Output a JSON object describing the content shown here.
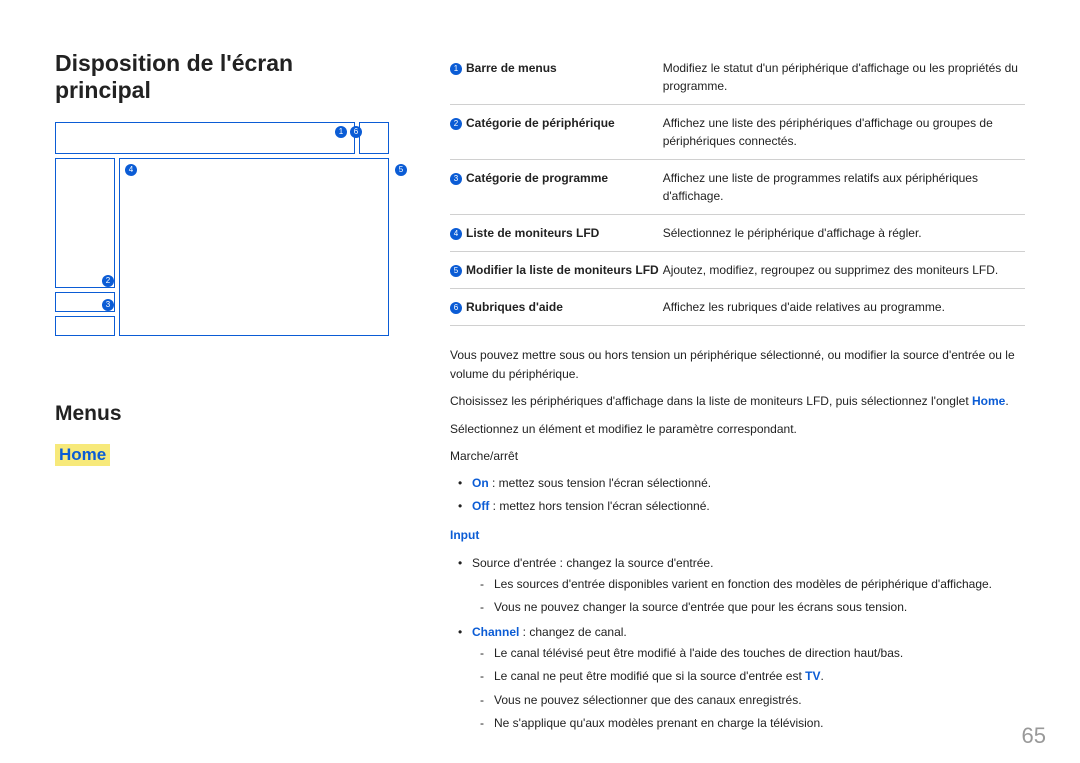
{
  "title": "Disposition de l'écran principal",
  "menus_heading": "Menus",
  "home_heading": "Home",
  "markers": {
    "m1": "1",
    "m2": "2",
    "m3": "3",
    "m4": "4",
    "m5": "5",
    "m6": "6"
  },
  "table": [
    {
      "num": "1",
      "label": "Barre de menus",
      "desc": "Modifiez le statut d'un périphérique d'affichage ou les propriétés du programme."
    },
    {
      "num": "2",
      "label": "Catégorie de périphérique",
      "desc": "Affichez une liste des périphériques d'affichage ou groupes de périphériques connectés."
    },
    {
      "num": "3",
      "label": "Catégorie de programme",
      "desc": "Affichez une liste de programmes relatifs aux périphériques d'affichage."
    },
    {
      "num": "4",
      "label": "Liste de moniteurs LFD",
      "desc": "Sélectionnez le périphérique d'affichage à régler."
    },
    {
      "num": "5",
      "label": "Modifier la liste de moniteurs LFD",
      "desc": "Ajoutez, modifiez, regroupez ou supprimez des moniteurs LFD."
    },
    {
      "num": "6",
      "label": "Rubriques d'aide",
      "desc": "Affichez les rubriques d'aide relatives au programme."
    }
  ],
  "desc": {
    "p1": "Vous pouvez mettre sous ou hors tension un périphérique sélectionné, ou modifier la source d'entrée ou le volume du périphérique.",
    "p2a": "Choisissez les périphériques d'affichage dans la liste de moniteurs LFD, puis sélectionnez l'onglet ",
    "p2b": "Home",
    "p2c": ".",
    "p3": "Sélectionnez un élément et modifiez le paramètre correspondant.",
    "p4": "Marche/arrêt",
    "on_label": "On",
    "on_text": " : mettez sous tension l'écran sélectionné.",
    "off_label": "Off",
    "off_text": " : mettez hors tension l'écran sélectionné.",
    "input_heading": "Input",
    "src_text": "Source d'entrée : changez la source d'entrée.",
    "src_d1": "Les sources d'entrée disponibles varient en fonction des modèles de périphérique d'affichage.",
    "src_d2": "Vous ne pouvez changer la source d'entrée que pour les écrans sous tension.",
    "channel_label": "Channel",
    "channel_text": " : changez de canal.",
    "ch_d1": "Le canal télévisé peut être modifié à l'aide des touches de direction haut/bas.",
    "ch_d2a": "Le canal ne peut être modifié que si la source d'entrée est ",
    "ch_d2b": "TV",
    "ch_d2c": ".",
    "ch_d3": "Vous ne pouvez sélectionner que des canaux enregistrés.",
    "ch_d4": "Ne s'applique qu'aux modèles prenant en charge la télévision."
  },
  "page_number": "65"
}
